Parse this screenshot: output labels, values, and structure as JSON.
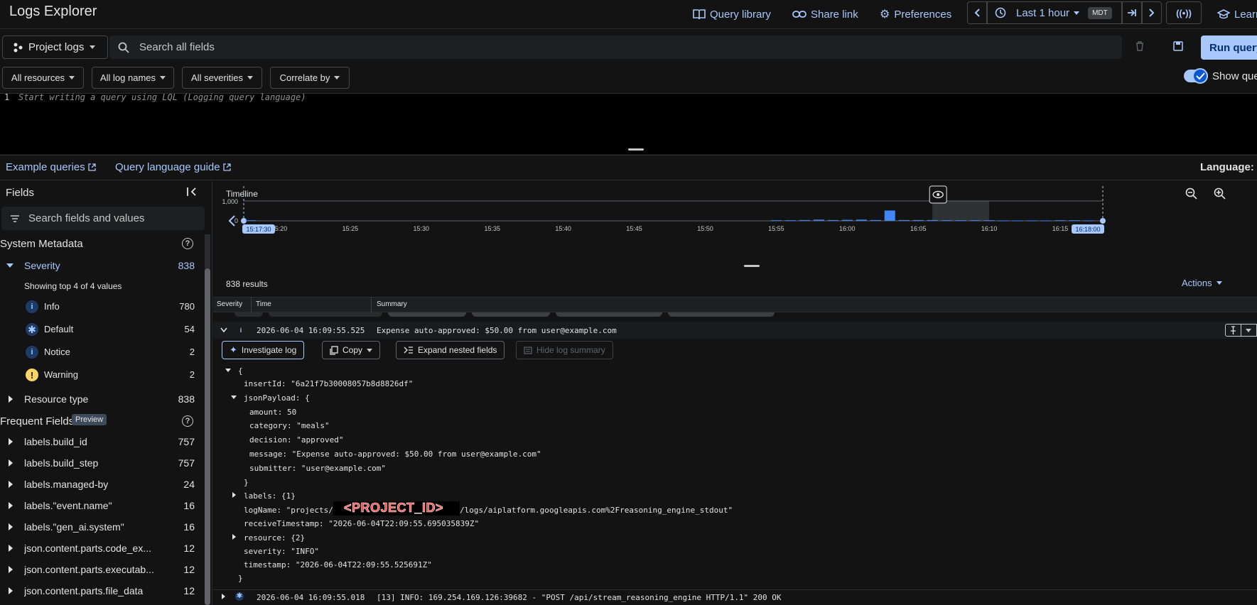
{
  "header": {
    "app_title": "Logs Explorer",
    "query_library": "Query library",
    "share_link": "Share link",
    "preferences": "Preferences",
    "time_range": "Last 1 hour",
    "timezone": "MDT",
    "learn": "Learn"
  },
  "search": {
    "project_scope": "Project logs",
    "placeholder": "Search all fields",
    "run_query": "Run query"
  },
  "filters": {
    "resources": "All resources",
    "log_names": "All log names",
    "severities": "All severities",
    "correlate": "Correlate by",
    "show_query_label": "Show query"
  },
  "editor": {
    "line_number": "1",
    "placeholder": "Start writing a query using LQL (Logging query language)"
  },
  "links": {
    "example_queries": "Example queries",
    "query_language_guide": "Query language guide",
    "language_label": "Language: LQL"
  },
  "fields_panel": {
    "title": "Fields",
    "search_placeholder": "Search fields and values",
    "system_metadata": "System Metadata",
    "severity_label": "Severity",
    "severity_count": "838",
    "showing_top": "Showing top 4 of 4 values",
    "severities": [
      {
        "label": "Info",
        "count": "780",
        "icon": "info-icon",
        "color": "#a8c7fa"
      },
      {
        "label": "Default",
        "count": "54",
        "icon": "asterisk-icon",
        "color": "#a8c7fa"
      },
      {
        "label": "Notice",
        "count": "2",
        "icon": "info-icon",
        "color": "#a8c7fa"
      },
      {
        "label": "Warning",
        "count": "2",
        "icon": "warning-icon",
        "color": "#fdd663"
      }
    ],
    "resource_type_label": "Resource type",
    "resource_type_count": "838",
    "frequent_fields": "Frequent Fields",
    "preview_badge": "Preview",
    "frequent": [
      {
        "label": "labels.build_id",
        "count": "757"
      },
      {
        "label": "labels.build_step",
        "count": "757"
      },
      {
        "label": "labels.managed-by",
        "count": "24"
      },
      {
        "label": "labels.\"event.name\"",
        "count": "16"
      },
      {
        "label": "labels.\"gen_ai.system\"",
        "count": "16"
      },
      {
        "label": "json.content.parts.code_ex...",
        "count": "12"
      },
      {
        "label": "json.content.parts.executab...",
        "count": "12"
      },
      {
        "label": "json.content.parts.file_data",
        "count": "12"
      }
    ]
  },
  "timeline": {
    "title": "Timeline",
    "y_ticks": [
      "1,000",
      "0"
    ],
    "start": "15:17:30",
    "end": "16:18:00",
    "x_ticks": [
      "15:20",
      "15:25",
      "15:30",
      "15:35",
      "15:40",
      "15:45",
      "15:50",
      "15:55",
      "16:00",
      "16:05",
      "16:10",
      "16:15"
    ]
  },
  "chart_data": {
    "type": "bar",
    "title": "Timeline",
    "xlabel": "",
    "ylabel": "",
    "ylim": [
      0,
      1000
    ],
    "x_range": [
      "15:17:30",
      "16:18:00"
    ],
    "categories": [
      "15:18",
      "15:55",
      "15:56",
      "15:57",
      "15:58",
      "15:59",
      "16:00",
      "16:01",
      "16:02",
      "16:03",
      "16:04",
      "16:05",
      "16:06",
      "16:07",
      "16:08",
      "16:09",
      "16:10",
      "16:11",
      "16:12",
      "16:13",
      "16:14",
      "16:15",
      "16:16",
      "16:17"
    ],
    "values": [
      30,
      30,
      30,
      40,
      60,
      40,
      50,
      60,
      40,
      520,
      40,
      40,
      40,
      30,
      30,
      30,
      30,
      20,
      20,
      20,
      20,
      30,
      30,
      20
    ],
    "highlight_range": [
      "16:06",
      "16:10"
    ]
  },
  "results": {
    "count": "838 results",
    "actions": "Actions",
    "columns": [
      "Severity",
      "Time",
      "Summary"
    ]
  },
  "log_entry": {
    "timestamp": "2026-06-04 16:09:55.525",
    "severity_icon": "i",
    "summary": "Expense auto-approved: $50.00 from user@example.com",
    "actions": {
      "investigate": "Investigate log",
      "copy": "Copy",
      "expand": "Expand nested fields",
      "hide_summary": "Hide log summary"
    },
    "json_lines": [
      "{",
      "insertId: \"6a21f7b30008057b8d8826df\"",
      "jsonPayload: {",
      "amount: 50",
      "category: \"meals\"",
      "decision: \"approved\"",
      "message: \"Expense auto-approved: $50.00 from user@example.com\"",
      "submitter: \"user@example.com\"",
      "}",
      "labels: {1}",
      "logName: \"projects/",
      "/logs/aiplatform.googleapis.com%2Freasoning_engine_stdout\"",
      "receiveTimestamp: \"2026-06-04T22:09:55.695035839Z\"",
      "resource: {2}",
      "severity: \"INFO\"",
      "timestamp: \"2026-06-04T22:09:55.525691Z\"",
      "}"
    ],
    "redaction": "<PROJECT_ID>"
  },
  "next_entry": {
    "timestamp": "2026-06-04 16:09:55.018",
    "summary": "[13]      INFO:     169.254.169.126:39682 - \"POST /api/stream_reasoning_engine HTTP/1.1\" 200 OK"
  },
  "colors": {
    "accent": "#a8c7fa",
    "background": "#131314",
    "bar": "#4285f4"
  }
}
